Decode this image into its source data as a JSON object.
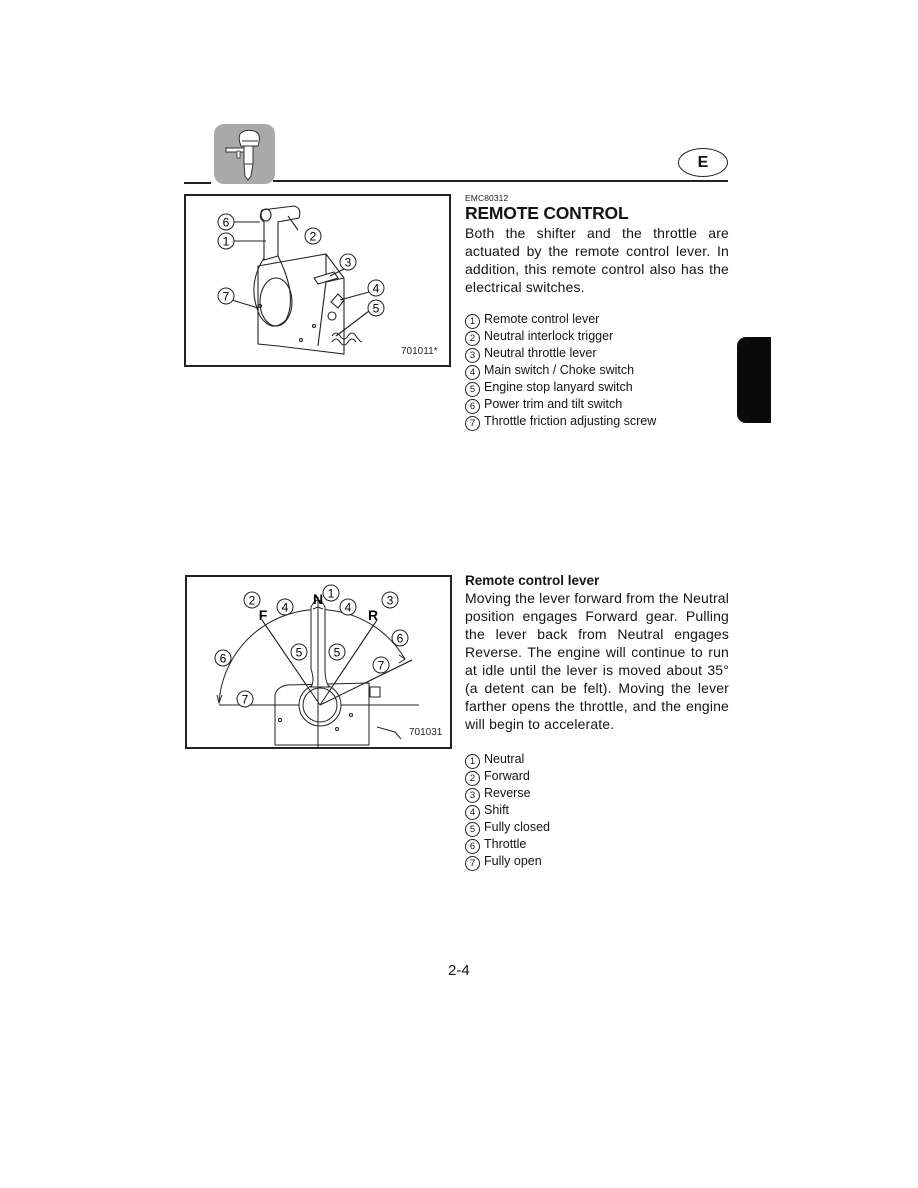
{
  "header": {
    "chapter_icon": "outboard-motor-icon",
    "language_badge": "E"
  },
  "section": {
    "doc_code": "EMC80312",
    "title": "REMOTE CONTROL",
    "intro": "Both the shifter and the throttle are actuated by the remote control lever. In addition, this remote control also has the electrical switches."
  },
  "figure1": {
    "code": "701011*",
    "callouts": [
      "6",
      "1",
      "2",
      "3",
      "7",
      "4",
      "5"
    ]
  },
  "parts_list": [
    {
      "num": "1",
      "label": "Remote control lever"
    },
    {
      "num": "2",
      "label": "Neutral interlock trigger"
    },
    {
      "num": "3",
      "label": "Neutral throttle lever"
    },
    {
      "num": "4",
      "label": "Main switch / Choke switch"
    },
    {
      "num": "5",
      "label": "Engine stop lanyard switch"
    },
    {
      "num": "6",
      "label": "Power trim and tilt switch"
    },
    {
      "num": "7",
      "label": "Throttle friction adjusting screw"
    }
  ],
  "subsection": {
    "title": "Remote control lever",
    "body": "Moving the lever forward from the Neutral position engages Forward gear. Pulling the lever back from Neutral engages Reverse. The engine will continue to run at idle until the lever is moved about 35° (a detent can be felt). Moving the lever farther opens the throttle, and the engine will begin to accelerate."
  },
  "figure2": {
    "code": "701031",
    "letters": {
      "neutral": "N",
      "forward": "F",
      "reverse": "R"
    }
  },
  "positions_list": [
    {
      "num": "1",
      "label": "Neutral"
    },
    {
      "num": "2",
      "label": "Forward"
    },
    {
      "num": "3",
      "label": "Reverse"
    },
    {
      "num": "4",
      "label": "Shift"
    },
    {
      "num": "5",
      "label": "Fully closed"
    },
    {
      "num": "6",
      "label": "Throttle"
    },
    {
      "num": "7",
      "label": "Fully open"
    }
  ],
  "footer": {
    "page_number": "2-4"
  }
}
